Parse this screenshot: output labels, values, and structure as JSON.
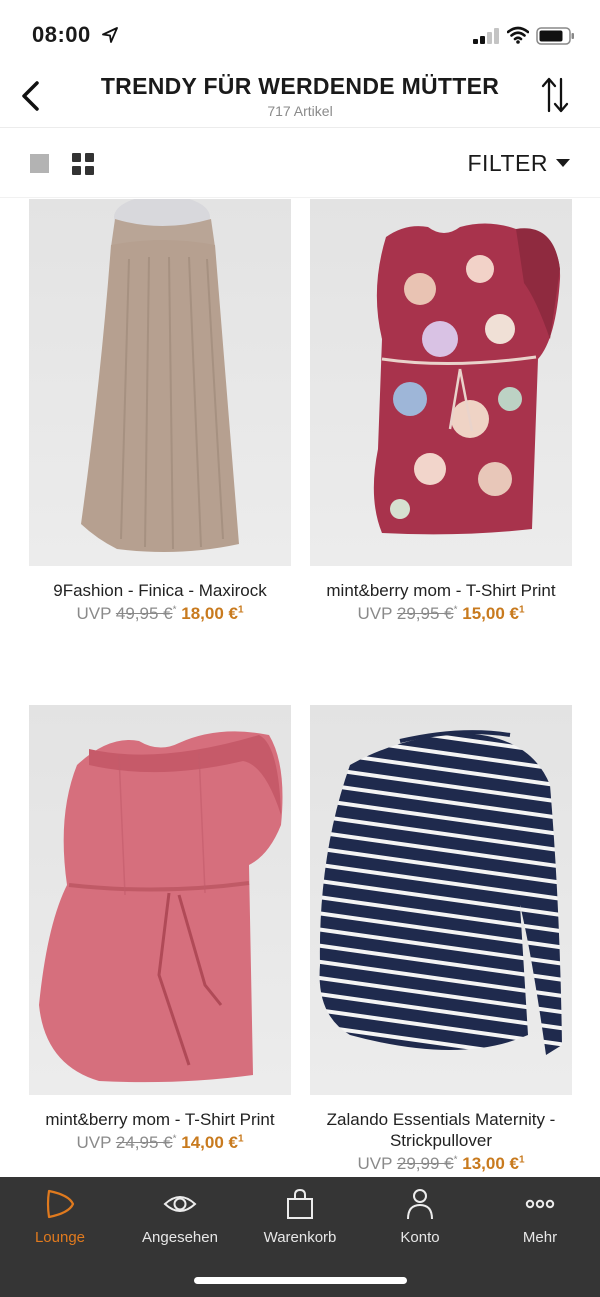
{
  "status_bar": {
    "time": "08:00"
  },
  "header": {
    "title": "TRENDY FÜR WERDENDE MÜTTER",
    "subtitle": "717 Artikel"
  },
  "toolbar": {
    "filter_label": "FILTER"
  },
  "products": [
    {
      "name": "9Fashion - Finica - Maxirock",
      "uvp": "UVP",
      "old_price": "49,95 €",
      "old_sup": "*",
      "new_price": "18,00 €",
      "new_sup": "1"
    },
    {
      "name": "mint&berry mom - T-Shirt Print",
      "uvp": "UVP",
      "old_price": "29,95 €",
      "old_sup": "*",
      "new_price": "15,00 €",
      "new_sup": "1"
    },
    {
      "name": "mint&berry mom - T-Shirt Print",
      "uvp": "UVP",
      "old_price": "24,95 €",
      "old_sup": "*",
      "new_price": "14,00 €",
      "new_sup": "1"
    },
    {
      "name": "Zalando Essentials Maternity - Strickpullover",
      "uvp": "UVP",
      "old_price": "29,99 €",
      "old_sup": "*",
      "new_price": "13,00 €",
      "new_sup": "1"
    }
  ],
  "bottom_nav": [
    {
      "label": "Lounge",
      "icon": "lounge-icon",
      "active": true
    },
    {
      "label": "Angesehen",
      "icon": "eye-icon"
    },
    {
      "label": "Warenkorb",
      "icon": "bag-icon"
    },
    {
      "label": "Konto",
      "icon": "user-icon"
    },
    {
      "label": "Mehr",
      "icon": "more-icon"
    }
  ],
  "colors": {
    "accent": "#e07a1e",
    "price": "#c87a1e",
    "nav_bg": "#353535"
  }
}
